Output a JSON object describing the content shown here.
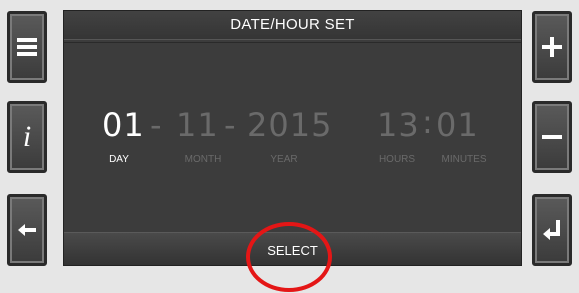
{
  "header": {
    "title": "DATE/HOUR SET"
  },
  "fields": {
    "day": {
      "value": "01",
      "label": "DAY"
    },
    "month": {
      "value": "11",
      "label": "MONTH"
    },
    "year": {
      "value": "2015",
      "label": "YEAR"
    },
    "hours": {
      "value": "13",
      "label": "HOURS"
    },
    "minutes": {
      "value": "01",
      "label": "MINUTES"
    }
  },
  "separators": {
    "date": "-",
    "time": ":"
  },
  "footer": {
    "select_label": "SELECT"
  },
  "icons": {
    "left": [
      "menu-icon",
      "info-icon",
      "back-arrow-icon"
    ],
    "right": [
      "plus-icon",
      "minus-icon",
      "enter-icon"
    ]
  },
  "colors": {
    "active": "#ffffff",
    "inactive": "#6a6a6a",
    "highlight": "#e41616"
  }
}
